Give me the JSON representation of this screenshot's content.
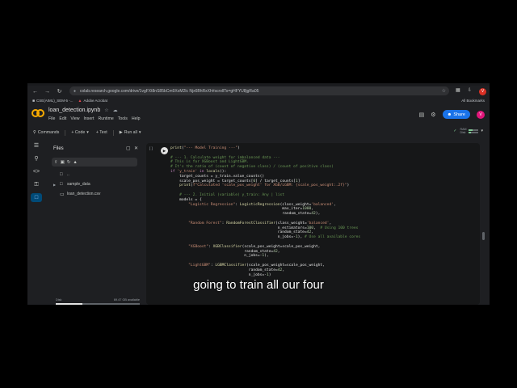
{
  "browser": {
    "url": "colab.research.google.com/drive/1vgFXt8nS85bCm9XoM2lc Njx6BhRxXh#scrollTo=gHFYU8jgRa05",
    "bookmarks": [
      {
        "label": "CSE(AIML)_SEM-5 -..."
      },
      {
        "label": "Adobe Acrobat"
      }
    ],
    "all_bookmarks": "All Bookmarks",
    "profile_initial": "V"
  },
  "colab": {
    "notebook_title": "loan_detection.ipynb",
    "menu": [
      "File",
      "Edit",
      "View",
      "Insert",
      "Runtime",
      "Tools",
      "Help"
    ],
    "share_label": "Share",
    "avatar_initial": "V"
  },
  "toolbar": {
    "commands": "Commands",
    "code": "+ Code",
    "text": "+ Text",
    "run_all": "Run all",
    "ram_label": "RAM",
    "disk_label": "Disk",
    "ram_fraction": 0.35,
    "disk_fraction": 0.2
  },
  "files_panel": {
    "title": "Files",
    "items": [
      {
        "name": "..",
        "type": "folder",
        "expandable": false
      },
      {
        "name": "sample_data",
        "type": "folder",
        "expandable": true
      },
      {
        "name": "loan_detection.csv",
        "type": "file",
        "expandable": false
      }
    ],
    "disk_label": "Disk",
    "disk_usage": "69.47 GB available",
    "disk_fraction": 0.32
  },
  "cell": {
    "bracket": "[ ]",
    "lines": [
      "print(\"--- Model Training ---\")",
      "",
      "# --- 1. Calculate weight for imbalanced data ---",
      "# This is for XGBoost and LightGBM.",
      "# It's the ratio of (count of negative class) / (count of positive class)",
      "if 'y_train' in locals():",
      "    target_counts = y_train.value_counts()",
      "    scale_pos_weight = target_counts[0] / target_counts[1]",
      "    print(f\"Calculated 'scale_pos_weight' for XGB/LGBM: {scale_pos_weight:.2f}\")",
      "",
      "    # --- 2. Initial (variable) y_train: Any | list",
      "    models = {",
      "        \"Logistic Regression\": LogisticRegression(class_weight='balanced',",
      "                                                  max_iter=1000,",
      "                                                  random_state=42),",
      "",
      "        \"Random Forest\": RandomForestClassifier(class_weight='balanced',",
      "                                                n_estimators=100,  # Using 100 trees",
      "                                                random_state=42,",
      "                                                n_jobs=-1), # Use all available cores",
      "",
      "        \"XGBoost\": XGBClassifier(scale_pos_weight=scale_pos_weight,",
      "                                 random_state=42,",
      "                                 n_jobs=-1),",
      "",
      "        \"LightGBM\": LGBMClassifier(scale_pos_weight=scale_pos_weight,",
      "                                   random_state=42,",
      "                                   n_jobs=-1)"
    ]
  },
  "caption": "going to train all our four"
}
